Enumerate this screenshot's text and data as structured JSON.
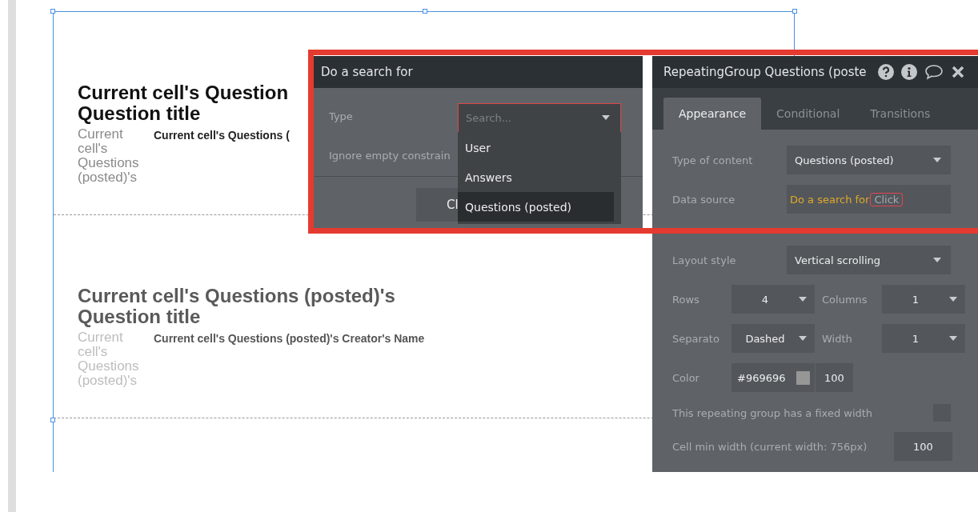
{
  "canvas": {
    "cells": [
      {
        "title": "Current cell's Question\nQuestion title",
        "subtitle": "Current cell's Questions (posted)'s",
        "creator": "Current cell's Questions (",
        "dimmed": false
      },
      {
        "title": "Current cell's Questions (posted)'s\nQuestion title",
        "subtitle": "Current cell's Questions (posted)'s",
        "creator": "Current cell's Questions (posted)'s Creator's Name",
        "dimmed": true
      }
    ]
  },
  "search_popup": {
    "title": "Do a search for",
    "type_label": "Type",
    "type_placeholder": "Search...",
    "ignore_label": "Ignore empty constrain",
    "button": "Cl",
    "options": [
      {
        "label": "User",
        "selected": false
      },
      {
        "label": "Answers",
        "selected": false
      },
      {
        "label": "Questions (posted)",
        "selected": true
      }
    ]
  },
  "panel": {
    "title": "RepeatingGroup Questions (poste",
    "tabs": [
      {
        "label": "Appearance",
        "selected": true
      },
      {
        "label": "Conditional",
        "selected": false
      },
      {
        "label": "Transitions",
        "selected": false
      }
    ],
    "rows": [
      {
        "kind": "select",
        "label": "Type of content",
        "value": "Questions (posted)"
      },
      {
        "kind": "source",
        "label": "Data source",
        "value": "Do a search for",
        "action": "Click"
      },
      {
        "kind": "select",
        "label": "Layout style",
        "value": "Vertical scrolling"
      },
      {
        "kind": "pair",
        "items": [
          {
            "label": "Rows",
            "value": "4"
          },
          {
            "label": "Columns",
            "value": "1"
          }
        ]
      },
      {
        "kind": "pair",
        "items": [
          {
            "label": "Separato",
            "value": "Dashed"
          },
          {
            "label": "Width",
            "value": "1"
          }
        ]
      },
      {
        "kind": "color",
        "label": "Color",
        "value": "#969696",
        "color": "#969696",
        "opacity": "100"
      },
      {
        "kind": "checkbox",
        "label": "This repeating group has a fixed width",
        "checked": false
      },
      {
        "kind": "number",
        "label": "Cell min width (current width: 756px)",
        "value": "100"
      }
    ]
  }
}
